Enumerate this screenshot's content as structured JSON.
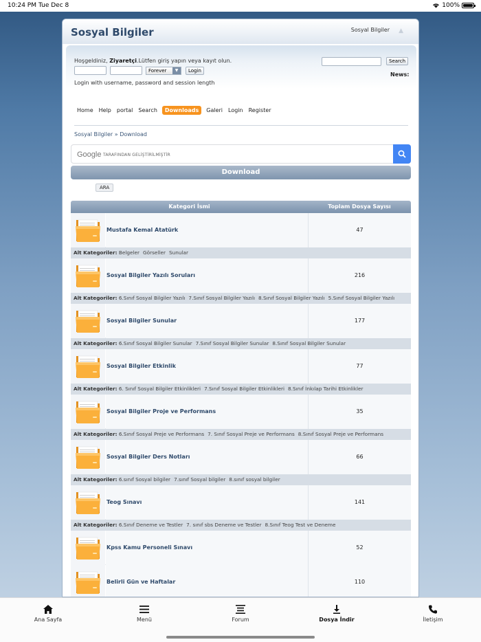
{
  "status": {
    "time": "10:24 PM",
    "date": "Tue Dec 8",
    "battery": "100%"
  },
  "site": {
    "title": "Sosyal Bilgiler",
    "header_right": "Sosyal Bilgiler"
  },
  "login": {
    "welcome_prefix": "Hoşgeldiniz, ",
    "welcome_user": "Ziyaretçi",
    "welcome_suffix": ".Lütfen giriş yapın veya kayıt olun.",
    "session_value": "Forever",
    "login_button": "Login",
    "hint": "Login with username, password and session length",
    "search_button": "Search",
    "news_label": "News:"
  },
  "menu": [
    "Home",
    "Help",
    "portal",
    "Search",
    "Downloads",
    "Galeri",
    "Login",
    "Register"
  ],
  "menu_active": "Downloads",
  "breadcrumb": {
    "root": "Sosyal Bilgiler",
    "sep": "»",
    "current": "Download"
  },
  "google": {
    "logo": "Google",
    "text": "TARAFINDAN GELİŞTİRİLMİŞTİR"
  },
  "download_title": "Download",
  "ara_button": "ARA",
  "table": {
    "col_category": "Kategori İsmi",
    "col_count": "Toplam Dosya Sayısı",
    "sub_label": "Alt Kategoriler:",
    "rows": [
      {
        "name": "Mustafa Kemal Atatürk",
        "count": "47",
        "subs": [
          "Belgeler",
          "Görseller",
          "Sunular"
        ]
      },
      {
        "name": "Sosyal Bilgiler Yazılı Soruları",
        "count": "216",
        "subs": [
          "6.Sınıf Sosyal Bilgiler Yazılı",
          "7.Sınıf Sosyal Bilgiler Yazılı",
          "8.Sınıf Sosyal Bilgiler Yazılı",
          "5.Sınıf Sosyal Bilgiler Yazılı"
        ]
      },
      {
        "name": "Sosyal Bilgiler Sunular",
        "count": "177",
        "subs": [
          "6.Sınıf Sosyal Bilgiler Sunular",
          "7.Sınıf Sosyal Bilgiler Sunular",
          "8.Sınıf Sosyal Bilgiler Sunular"
        ]
      },
      {
        "name": "Sosyal Bilgiler Etkinlik",
        "count": "77",
        "subs": [
          "6. Sınıf Sosyal Bilgiler Etkinlikleri",
          "7.Sınıf Sosyal Bilgiler Etkinlikleri",
          "8.Sınıf İnkılap Tarihi Etkinlikler"
        ]
      },
      {
        "name": "Sosyal Bilgiler Proje ve Performans",
        "count": "35",
        "subs": [
          "6.Sınıf Sosyal Preje ve Performans",
          "7. Sınıf Sosyal Preje ve Performans",
          "8.Sınıf Sosyal Preje ve Performans"
        ]
      },
      {
        "name": "Sosyal Bilgiler Ders Notları",
        "count": "66",
        "subs": [
          "6.sınıf Sosyal bilgiler",
          "7.sınıf Sosyal bilgiler",
          "8.sınıf sosyal bilgiler"
        ]
      },
      {
        "name": "Teog Sınavı",
        "count": "141",
        "subs": [
          "6.Sınıf Deneme ve Testler",
          "7. sınıf sbs Deneme ve Testler",
          "8.Sınıf Teog Test ve Deneme"
        ]
      },
      {
        "name": "Kpss Kamu Personeli Sınavı",
        "count": "52",
        "subs": []
      },
      {
        "name": "Belirli Gün ve Haftalar",
        "count": "110",
        "subs": []
      }
    ]
  },
  "tabbar": [
    {
      "label": "Ana Sayfa",
      "icon": "home-icon"
    },
    {
      "label": "Menü",
      "icon": "menu-icon"
    },
    {
      "label": "Forum",
      "icon": "forum-icon"
    },
    {
      "label": "Dosya İndir",
      "icon": "download-icon"
    },
    {
      "label": "İletişim",
      "icon": "phone-icon"
    }
  ],
  "tabbar_selected": "Dosya İndir",
  "colors": {
    "accent": "#f7931e",
    "title": "#2f4a6b",
    "google_blue": "#4285f4"
  }
}
